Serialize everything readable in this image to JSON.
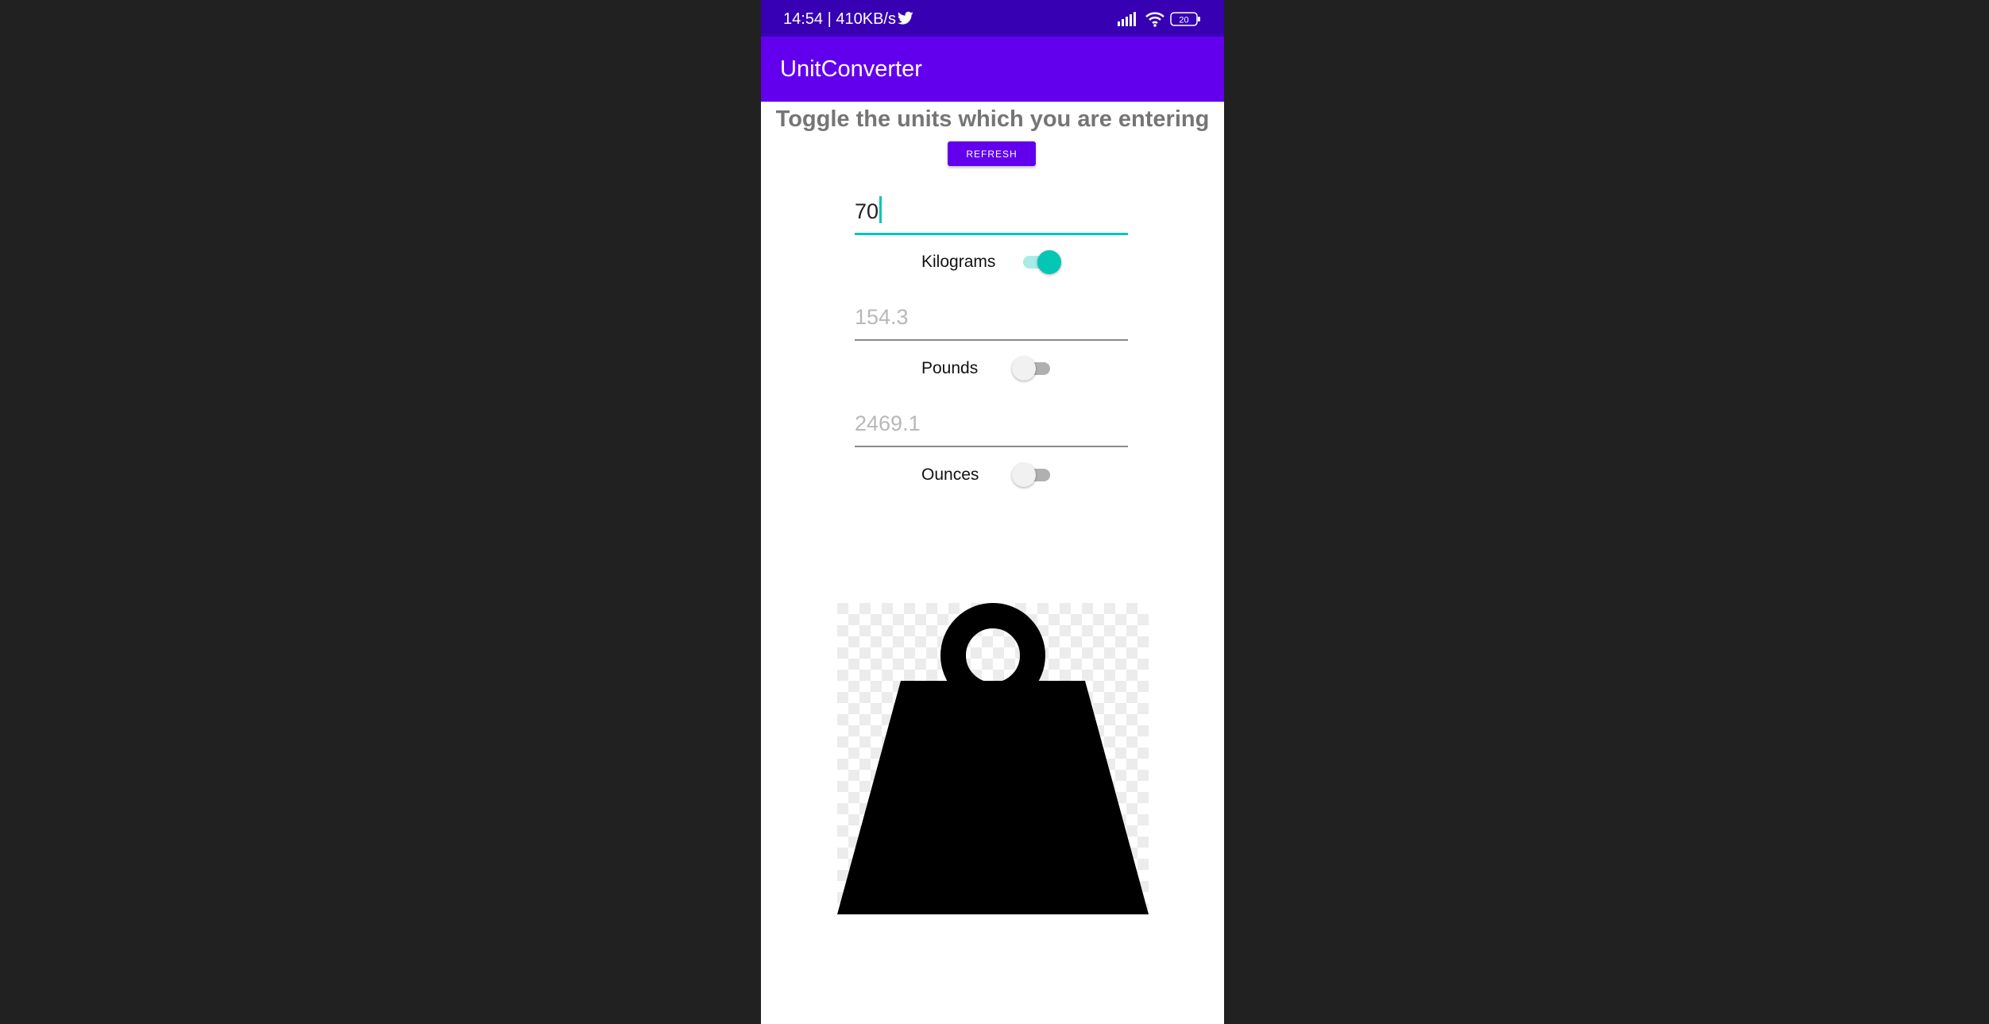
{
  "status_bar": {
    "time_speed": "14:54 | 410KB/s",
    "battery": "20",
    "icons": [
      "twitter-icon",
      "signal-icon",
      "wifi-icon",
      "battery-icon"
    ]
  },
  "app_bar": {
    "title": "UnitConverter"
  },
  "main": {
    "heading": "Toggle the units which you are entering",
    "refresh_label": "REFRESH",
    "rows": [
      {
        "value": "70",
        "unit_label": "Kilograms",
        "toggle_on": true
      },
      {
        "value": "154.3",
        "unit_label": "Pounds",
        "toggle_on": false
      },
      {
        "value": "2469.1",
        "unit_label": "Ounces",
        "toggle_on": false
      }
    ],
    "image_icon": "weight-icon"
  },
  "colors": {
    "status_bar": "#3700b3",
    "app_bar": "#6200ee",
    "accent": "#03c6b5",
    "background": "#212121"
  }
}
